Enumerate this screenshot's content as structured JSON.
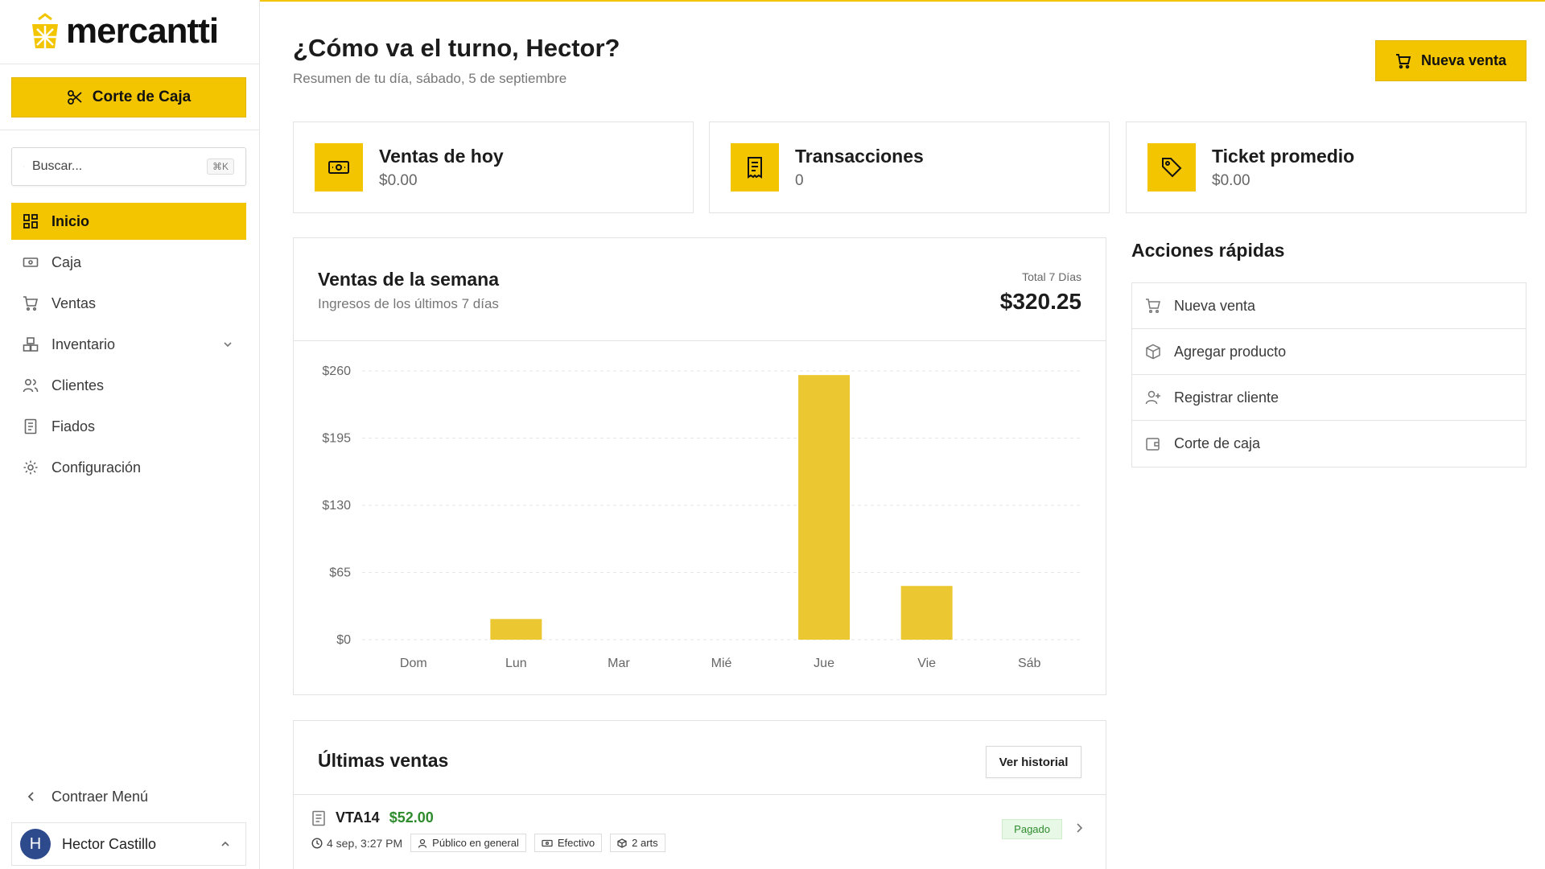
{
  "brand": {
    "name": "mercantti",
    "logo_icon": "grid-bag-logo",
    "accent": "#f2c500"
  },
  "sidebar": {
    "corte_button": "Corte de Caja",
    "search": {
      "placeholder": "Buscar...",
      "shortcut": "⌘K"
    },
    "items": [
      {
        "label": "Inicio",
        "icon": "grid-icon",
        "active": true
      },
      {
        "label": "Caja",
        "icon": "cash-icon"
      },
      {
        "label": "Ventas",
        "icon": "cart-icon"
      },
      {
        "label": "Inventario",
        "icon": "boxes-icon",
        "expandable": true
      },
      {
        "label": "Clientes",
        "icon": "users-icon"
      },
      {
        "label": "Fiados",
        "icon": "ledger-icon"
      },
      {
        "label": "Configuración",
        "icon": "gear-icon"
      }
    ],
    "collapse_label": "Contraer Menú",
    "user": {
      "initial": "H",
      "name": "Hector Castillo"
    }
  },
  "header": {
    "greeting": "¿Cómo va el turno, Hector?",
    "subtitle": "Resumen de tu día, sábado, 5 de septiembre",
    "new_sale_button": "Nueva venta"
  },
  "stats": [
    {
      "title": "Ventas de hoy",
      "value": "$0.00",
      "icon": "cash-icon"
    },
    {
      "title": "Transacciones",
      "value": "0",
      "icon": "receipt-icon"
    },
    {
      "title": "Ticket promedio",
      "value": "$0.00",
      "icon": "tag-icon"
    }
  ],
  "weekly": {
    "title": "Ventas de la semana",
    "subtitle": "Ingresos de los últimos 7 días",
    "total_label": "Total 7 Días",
    "total_value": "$320.25"
  },
  "chart_data": {
    "type": "bar",
    "categories": [
      "Dom",
      "Lun",
      "Mar",
      "Mié",
      "Jue",
      "Vie",
      "Sáb"
    ],
    "values": [
      0,
      20,
      0,
      0,
      256,
      52,
      0
    ],
    "ylim": [
      0,
      260
    ],
    "yticks": [
      0,
      65,
      130,
      195,
      260
    ],
    "ytick_labels": [
      "$0",
      "$65",
      "$130",
      "$195",
      "$260"
    ],
    "bar_color": "#ebc832",
    "grid": "horizontal dashed"
  },
  "quick_actions": {
    "title": "Acciones rápidas",
    "items": [
      {
        "label": "Nueva venta",
        "icon": "cart-icon"
      },
      {
        "label": "Agregar producto",
        "icon": "box-icon"
      },
      {
        "label": "Registrar cliente",
        "icon": "user-plus-icon"
      },
      {
        "label": "Corte de caja",
        "icon": "wallet-icon"
      }
    ]
  },
  "recent_sales": {
    "title": "Últimas ventas",
    "history_button": "Ver historial",
    "rows": [
      {
        "id": "VTA14",
        "amount": "$52.00",
        "time": "4 sep, 3:27 PM",
        "customer": "Público en general",
        "method": "Efectivo",
        "items": "2 arts",
        "status": "Pagado"
      }
    ]
  }
}
